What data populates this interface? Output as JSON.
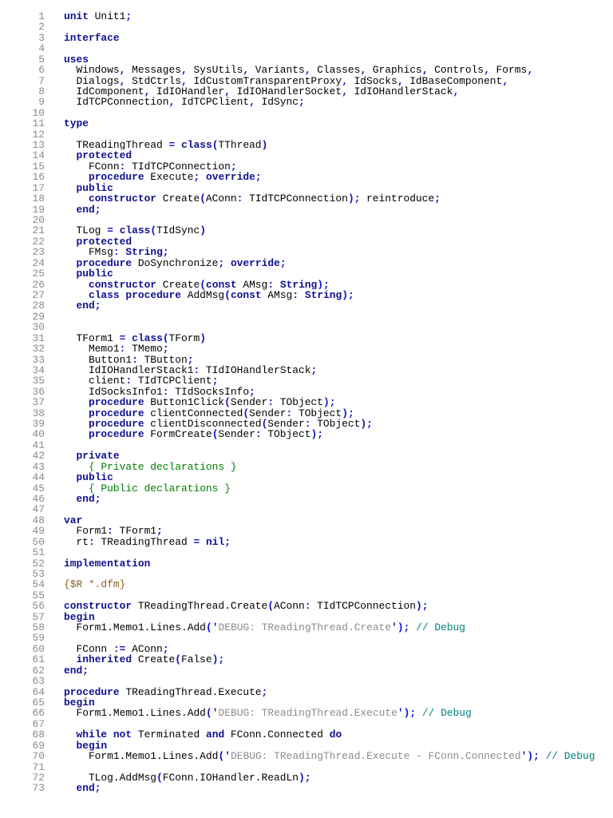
{
  "document": {
    "lines": [
      "unit Unit1;",
      "",
      "interface",
      "",
      "uses",
      "  Windows, Messages, SysUtils, Variants, Classes, Graphics, Controls, Forms,",
      "  Dialogs, StdCtrls, IdCustomTransparentProxy, IdSocks, IdBaseComponent,",
      "  IdComponent, IdIOHandler, IdIOHandlerSocket, IdIOHandlerStack,",
      "  IdTCPConnection, IdTCPClient, IdSync;",
      "",
      "type",
      "",
      "  TReadingThread = class(TThread)",
      "  protected",
      "    FConn: TIdTCPConnection;",
      "    procedure Execute; override;",
      "  public",
      "    constructor Create(AConn: TIdTCPConnection); reintroduce;",
      "  end;",
      "",
      "  TLog = class(TIdSync)",
      "  protected",
      "    FMsg: String;",
      "  procedure DoSynchronize; override;",
      "  public",
      "    constructor Create(const AMsg: String);",
      "    class procedure AddMsg(const AMsg: String);",
      "  end;",
      "",
      "",
      "  TForm1 = class(TForm)",
      "    Memo1: TMemo;",
      "    Button1: TButton;",
      "    IdIOHandlerStack1: TIdIOHandlerStack;",
      "    client: TIdTCPClient;",
      "    IdSocksInfo1: TIdSocksInfo;",
      "    procedure Button1Click(Sender: TObject);",
      "    procedure clientConnected(Sender: TObject);",
      "    procedure clientDisconnected(Sender: TObject);",
      "    procedure FormCreate(Sender: TObject);",
      "",
      "  private",
      "    { Private declarations }",
      "  public",
      "    { Public declarations }",
      "  end;",
      "",
      "var",
      "  Form1: TForm1;",
      "  rt: TReadingThread = nil;",
      "",
      "implementation",
      "",
      "{$R *.dfm}",
      "",
      "constructor TReadingThread.Create(AConn: TIdTCPConnection);",
      "begin",
      "  Form1.Memo1.Lines.Add('DEBUG: TReadingThread.Create'); // Debug",
      "",
      "  FConn := AConn;",
      "  inherited Create(False);",
      "end;",
      "",
      "procedure TReadingThread.Execute;",
      "begin",
      "  Form1.Memo1.Lines.Add('DEBUG: TReadingThread.Execute'); // Debug",
      "",
      "  while not Terminated and FConn.Connected do",
      "  begin",
      "    Form1.Memo1.Lines.Add('DEBUG: TReadingThread.Execute - FConn.Connected'); // Debug",
      "",
      "    TLog.AddMsg(FConn.IOHandler.ReadLn);",
      "  end;"
    ]
  }
}
